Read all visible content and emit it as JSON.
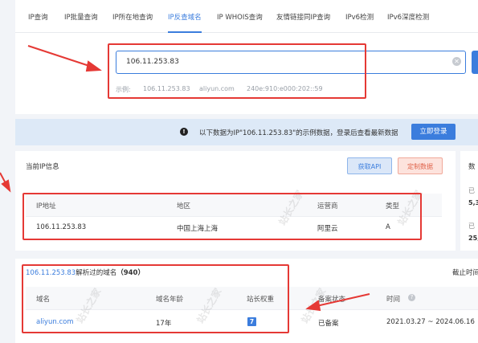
{
  "tabs": [
    {
      "label": "IP查询"
    },
    {
      "label": "IP批量查询"
    },
    {
      "label": "IP所在地查询"
    },
    {
      "label": "IP反查域名"
    },
    {
      "label": "IP WHOIS查询"
    },
    {
      "label": "友情链接同IP查询"
    },
    {
      "label": "IPv6检测"
    },
    {
      "label": "IPv6深度检测"
    }
  ],
  "active_tab": "IP反查域名",
  "search": {
    "value": "106.11.253.83",
    "clear_symbol": "✕",
    "examples_label": "示例:",
    "examples": [
      "106.11.253.83",
      "aliyun.com",
      "240e:910:e000:202::59"
    ]
  },
  "notice": {
    "icon": "!",
    "text": "以下数据为IP\"106.11.253.83\"的示例数据，登录后查看最新数据",
    "login_label": "立即登录"
  },
  "ip_info": {
    "title": "当前IP信息",
    "api_label": "获取API",
    "custom_label": "定制数据",
    "columns": [
      "IP地址",
      "地区",
      "运营商",
      "类型"
    ],
    "row": [
      "106.11.253.83",
      "中国上海上海",
      "阿里云",
      "A"
    ]
  },
  "side_panel": {
    "title": "数",
    "line1": "已",
    "value1": "5,3",
    "line2": "已",
    "value2": "25,"
  },
  "domains": {
    "title_ip": "106.11.253.83",
    "title_rest": "解析过的域名",
    "count": "（940）",
    "right_label": "截止时间",
    "columns": [
      "域名",
      "域名年龄",
      "站长权重",
      "备案状态",
      "时间"
    ],
    "rows": [
      {
        "domain": "aliyun.com",
        "age": "17年",
        "weight": "7",
        "status": "已备案",
        "time": "2021.03.27 ~ 2024.06.16"
      }
    ]
  },
  "watermark": "站长之家",
  "colors": {
    "accent": "#3b7ddd",
    "annotation": "#e53935"
  }
}
